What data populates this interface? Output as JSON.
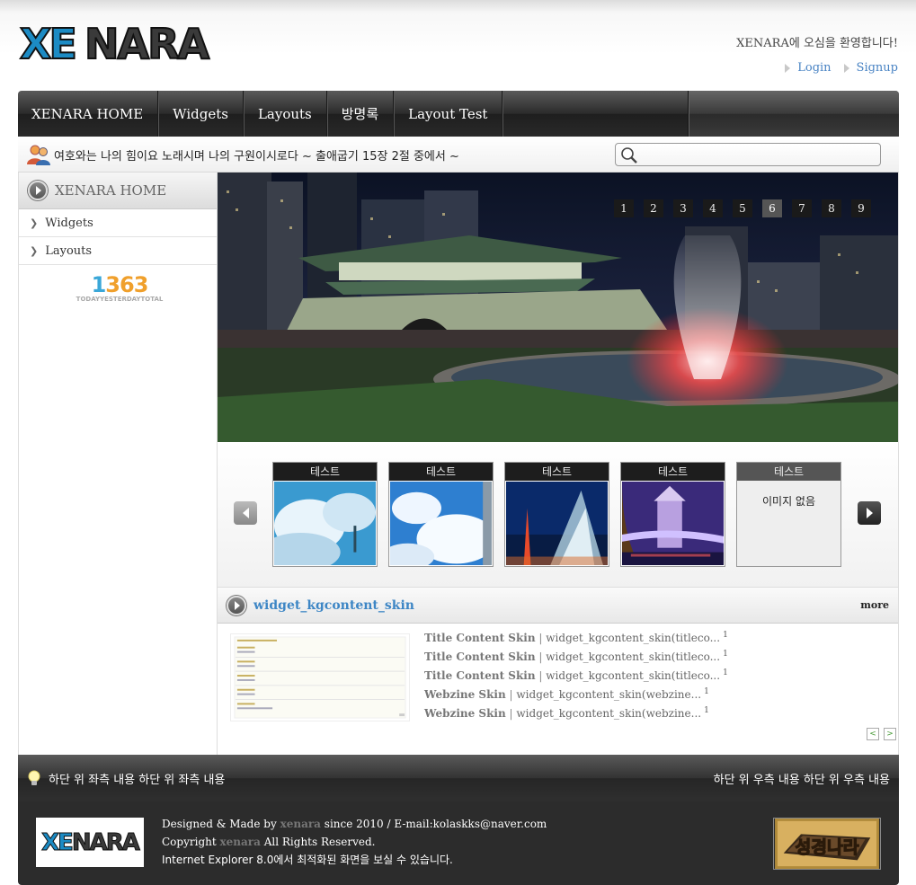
{
  "header": {
    "logo_xe": "XE",
    "logo_nara": "NARA",
    "welcome": "XENARA에 오심을 환영합니다!",
    "login": "Login",
    "signup": "Signup"
  },
  "nav": {
    "items": [
      "XENARA HOME",
      "Widgets",
      "Layouts",
      "방명록",
      "Layout Test"
    ]
  },
  "notice": {
    "text": "여호와는 나의 힘이요 노래시며 나의 구원이시로다 ~ 출애굽기 15장 2절 중에서 ~",
    "search_placeholder": ""
  },
  "sidebar": {
    "home": "XENARA HOME",
    "items": [
      "Widgets",
      "Layouts"
    ],
    "counter": {
      "today": "1",
      "yesterday_total": "363",
      "label": "TODAYYESTERDAYTOTAL"
    }
  },
  "slider": {
    "pages": [
      "1",
      "2",
      "3",
      "4",
      "5",
      "6",
      "7",
      "8",
      "9"
    ],
    "active_page": "6"
  },
  "carousel": {
    "items": [
      {
        "caption": "테스트",
        "image": "clouds-snow"
      },
      {
        "caption": "테스트",
        "image": "sky-clouds"
      },
      {
        "caption": "테스트",
        "image": "port-tower"
      },
      {
        "caption": "테스트",
        "image": "tower-bridge"
      },
      {
        "caption": "테스트",
        "no_image": "이미지 없음"
      }
    ]
  },
  "content_widget": {
    "title": "widget_kgcontent_skin",
    "more": "more",
    "rows": [
      {
        "title": "Title Content Skin",
        "text": "widget_kgcontent_skin(titleco...",
        "count": "1"
      },
      {
        "title": "Title Content Skin",
        "text": "widget_kgcontent_skin(titleco...",
        "count": "1"
      },
      {
        "title": "Title Content Skin",
        "text": "widget_kgcontent_skin(titleco...",
        "count": "1"
      },
      {
        "title": "Webzine Skin",
        "text": "widget_kgcontent_skin(webzine...",
        "count": "1"
      },
      {
        "title": "Webzine Skin",
        "text": "widget_kgcontent_skin(webzine...",
        "count": "1"
      }
    ],
    "prev": "<",
    "next": ">"
  },
  "footer": {
    "left": "하단 위 좌측 내용 하단 위 좌측 내용",
    "right": "하단 위 우측 내용 하단 위 우측 내용",
    "logo_xe": "XE",
    "logo_nara": "NARA",
    "designed_prefix": "Designed & Made by",
    "brand": "xenara",
    "designed_suffix": "since 2010 / E-mail:kolaskks@naver.com",
    "copyright_prefix": "Copyright",
    "copyright_suffix": "All Rights Reserved.",
    "ie_notice": "Internet Explorer 8.0에서 최적화된 화면을 보실 수 있습니다.",
    "badge": "성경나라"
  },
  "colors": {
    "link": "#4a84c4",
    "widget_title": "#3d86c5",
    "logo_blue": "#1c8bc4"
  }
}
